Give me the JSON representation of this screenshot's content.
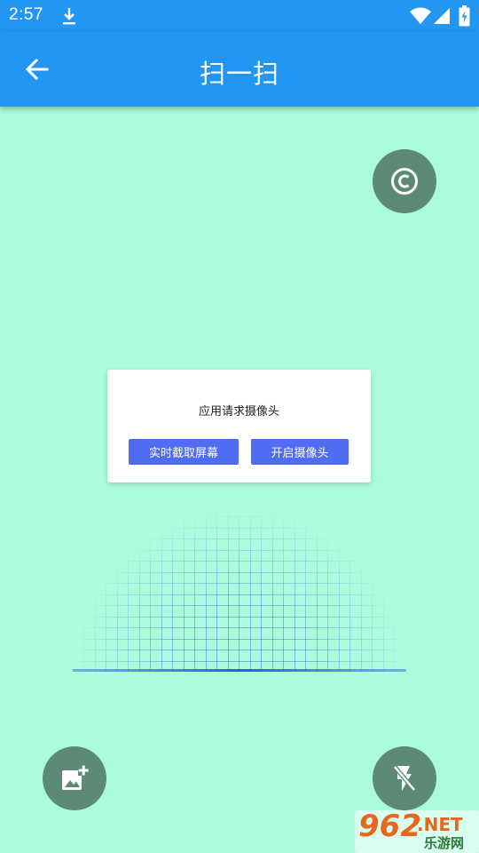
{
  "status_bar": {
    "time": "2:57",
    "icons": [
      "download-icon",
      "wifi-icon",
      "signal-icon",
      "battery-icon"
    ]
  },
  "app_bar": {
    "title": "扫一扫",
    "back_icon": "arrow-back-icon"
  },
  "fabs": {
    "copyright_icon": "copyright-icon",
    "gallery_icon": "add-photo-icon",
    "flash_icon": "flash-off-icon"
  },
  "dialog": {
    "message": "应用请求摄像头",
    "capture_button": "实时截取屏幕",
    "camera_button": "开启摄像头"
  },
  "watermark": {
    "brand": "962",
    "suffix": ".NET",
    "subtitle": "乐游网"
  },
  "colors": {
    "primary": "#2196f3",
    "background": "#abfcdc",
    "fab": "#5c8a76",
    "dialog_button": "#4f6cf2",
    "scan_line": "#4a7be8"
  }
}
